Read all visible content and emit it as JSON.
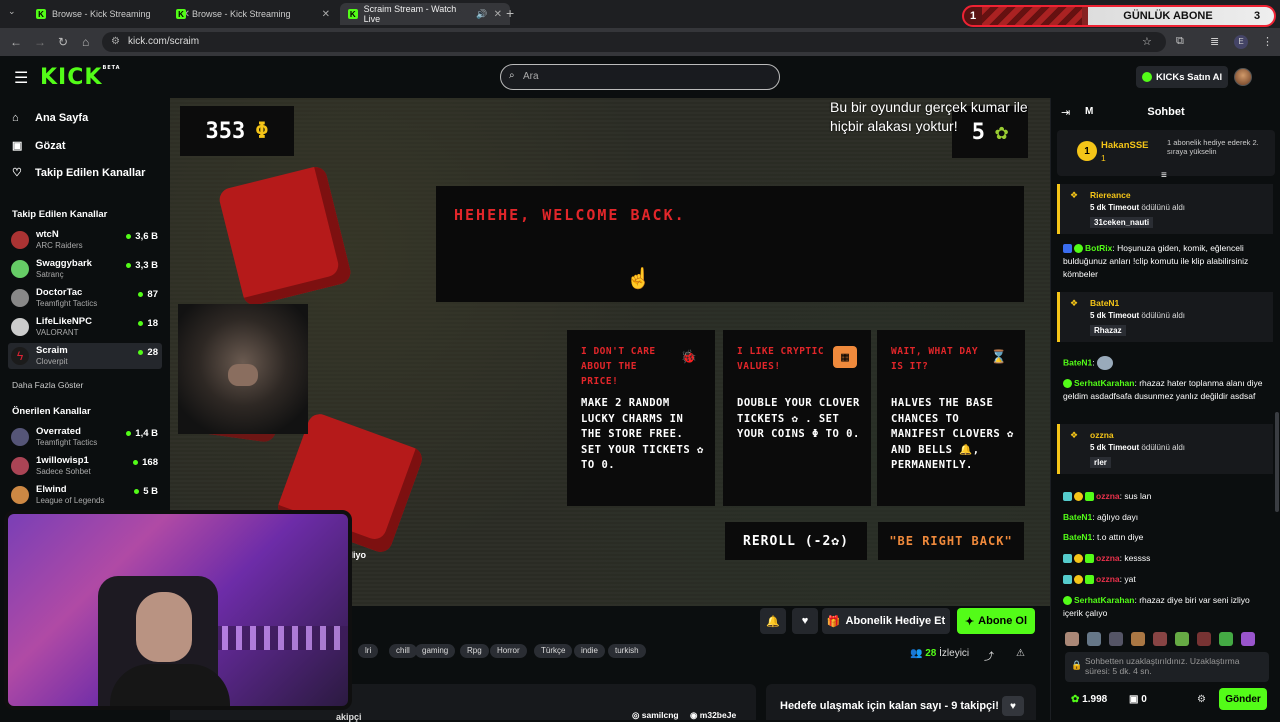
{
  "browser": {
    "tab_list_label": "⌄",
    "tabs": [
      {
        "title": "Browse - Kick Streaming",
        "fav": "K",
        "close": "✕"
      },
      {
        "title": "Browse - Kick Streaming",
        "fav": "K",
        "close": "✕"
      },
      {
        "title": "Scraim Stream - Watch Live",
        "fav": "K",
        "close": "✕"
      }
    ],
    "new_tab": "+",
    "url": "kick.com/scraim",
    "banner": {
      "left": "1",
      "title": "GÜNLÜK ABONE",
      "right": "3"
    }
  },
  "header": {
    "logo": "KICK",
    "logo_beta": "BETA",
    "search_placeholder": "Ara",
    "kicks_button": "KICKs Satın Al"
  },
  "sidebar": {
    "links": [
      {
        "label": "Ana Sayfa",
        "icon": "home-icon",
        "glyph": "⌂"
      },
      {
        "label": "Gözat",
        "icon": "browse-icon",
        "glyph": "▣"
      },
      {
        "label": "Takip Edilen Kanallar",
        "icon": "heart-icon",
        "glyph": "♡"
      }
    ],
    "followed_title": "Takip Edilen Kanallar",
    "followed": [
      {
        "name": "wtcN",
        "game": "ARC Raiders",
        "viewers": "3,6 B",
        "color": "#a33"
      },
      {
        "name": "Swaggybark",
        "game": "Satranç",
        "viewers": "3,3 B",
        "color": "#6c6"
      },
      {
        "name": "DoctorTac",
        "game": "Teamfight Tactics",
        "viewers": "87",
        "color": "#888"
      },
      {
        "name": "LifeLikeNPC",
        "game": "VALORANT",
        "viewers": "18",
        "color": "#ccc"
      },
      {
        "name": "Scraim",
        "game": "Cloverpit",
        "viewers": "28",
        "color": "#d23"
      }
    ],
    "show_more": "Daha Fazla Göster",
    "recommended_title": "Önerilen Kanallar",
    "recommended": [
      {
        "name": "Overrated",
        "game": "Teamfight Tactics",
        "viewers": "1,4 B",
        "color": "#557"
      },
      {
        "name": "1willowisp1",
        "game": "Sadece Sohbet",
        "viewers": "168",
        "color": "#a45"
      },
      {
        "name": "Elwind",
        "game": "League of Legends",
        "viewers": "5 B",
        "color": "#c84"
      }
    ]
  },
  "stream": {
    "coins": "353",
    "coin_symbol": "Φ",
    "tickets": "5",
    "ticket_symbol": "✿",
    "overlay_text": "Bu bir oyundur gerçek kumar ile hiçbir alakası yoktur!",
    "welcome": "HEHEHE, WELCOME BACK.",
    "cards": [
      {
        "head": "I DON'T CARE ABOUT THE PRICE!",
        "body": "MAKE 2 RANDOM LUCKY CHARMS IN THE STORE FREE. SET YOUR TICKETS ✿ TO 0.",
        "icon": "🐞",
        "icon_name": "ladybug-icon"
      },
      {
        "head": "I LIKE CRYPTIC VALUES!",
        "body": "DOUBLE YOUR CLOVER TICKETS ✿ . SET YOUR COINS Φ TO 0.",
        "icon": "▦",
        "icon_name": "slot-icon"
      },
      {
        "head": "WAIT, WHAT DAY IS IT?",
        "body": "HALVES THE BASE CHANCES TO MANIFEST CLOVERS ✿ AND BELLS 🔔, PERMANENTLY.",
        "icon": "⌛",
        "icon_name": "hourglass-icon"
      }
    ],
    "reroll": "REROLL (-2✿)",
    "brb": "\"BE RIGHT BACK\"",
    "partial_overlay": "zliyo"
  },
  "below": {
    "gift_button": "Abonelik Hediye Et",
    "subscribe_button": "Abone Ol",
    "tags": [
      "lri",
      "chill",
      "gaming",
      "Rpg",
      "Horror",
      "Türkçe",
      "indie",
      "turkish"
    ],
    "viewers_count": "28",
    "viewers_label": "İzleyici",
    "followers_partial": "akipçi",
    "socials": [
      "samilcng",
      "m32beJe"
    ],
    "goal_text": "Hedefe ulaşmak için kalan sayı - 9 takipçi!"
  },
  "chat": {
    "m_label": "M",
    "title": "Sohbet",
    "pinned": {
      "rank": "1",
      "name": "HakanSSE",
      "count": "1",
      "info": "1 abonelik hediye ederek 2. sıraya yükselin"
    },
    "messages": [
      {
        "type": "reward",
        "user": "Riereance",
        "text_pre": "5 dk Timeout",
        "text_post": " ödülünü aldı",
        "value": "31ceken_nauti"
      },
      {
        "type": "msg",
        "user": "BotRix",
        "color": "#53fc18",
        "text": "Hoşunuza giden, komik, eğlenceli bulduğunuz anları !clip komutu ile klip alabilirsiniz kömbeler"
      },
      {
        "type": "reward",
        "user": "BateN1",
        "text_pre": "5 dk Timeout",
        "text_post": " ödülünü aldı",
        "value": "Rhazaz"
      },
      {
        "type": "msg",
        "user": "BateN1",
        "color": "#53fc18",
        "text": ""
      },
      {
        "type": "msg",
        "user": "SerhatKarahan",
        "color": "#53fc18",
        "text": "rhazaz hater toplanma alanı diye geldim asdadfsafa dusunmez yanlız değildir asdsaf"
      },
      {
        "type": "reward",
        "user": "ozzna",
        "text_pre": "5 dk Timeout",
        "text_post": " ödülünü aldı",
        "value": "rler"
      },
      {
        "type": "msg",
        "user": "ozzna",
        "color": "#e8314b",
        "text": "sus lan"
      },
      {
        "type": "msg",
        "user": "BateN1",
        "color": "#53fc18",
        "text": "ağlıyo dayı"
      },
      {
        "type": "msg",
        "user": "BateN1",
        "color": "#53fc18",
        "text": "t.o attın diye"
      },
      {
        "type": "msg",
        "user": "ozzna",
        "color": "#e8314b",
        "text": "kessss"
      },
      {
        "type": "msg",
        "user": "ozzna",
        "color": "#e8314b",
        "text": "yat"
      },
      {
        "type": "msg",
        "user": "SerhatKarahan",
        "color": "#53fc18",
        "text": "rhazaz diye biri var seni izliyo içerik çalıyo"
      }
    ],
    "input_text": "Sohbetten uzaklaştırıldınız. Uzaklaştırma süresi: 5 dk. 4 sn.",
    "points": "1.998",
    "kicks": "0",
    "send": "Gönder"
  }
}
